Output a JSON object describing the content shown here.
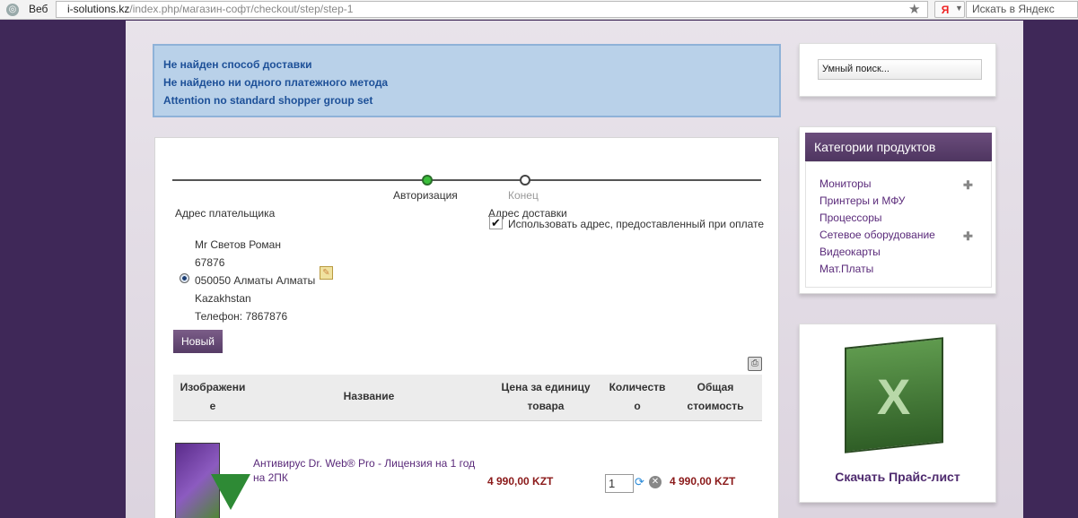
{
  "browser": {
    "tab_label": "Веб",
    "url_domain": "i-solutions.kz",
    "url_path": "/index.php/магазин-софт/checkout/step/step-1",
    "yandex_icon": "Я",
    "yandex_search": "Искать в Яндекс",
    "star_icon": "★"
  },
  "messages": [
    "Не найден способ доставки",
    "Не найдено ни одного платежного метода",
    "Attention no standard shopper group set"
  ],
  "checkout": {
    "steps": [
      "Авторизация",
      "Конец"
    ],
    "billing_label": "Адрес плательщика",
    "shipping_label": "Адрес доставки",
    "use_billing_label": "Использовать адрес, предоставленный при оплате",
    "checked_mark": "✔",
    "address": [
      "Mr Светов Роман",
      "67876",
      "050050 Алматы Алматы",
      "Kazakhstan",
      "Телефон: 7867876"
    ],
    "new_button": "Новый",
    "table": {
      "headers": {
        "image": [
          "Изображени",
          "е"
        ],
        "name": "Название",
        "price": [
          "Цена за единицу",
          "товара"
        ],
        "qty": [
          "Количеств",
          "о"
        ],
        "total": [
          "Общая",
          "стоимость"
        ]
      },
      "rows": [
        {
          "name": "Антивирус Dr. Web® Pro - Лицензия на 1 год на 2ПК",
          "price": "4 990,00 KZT",
          "qty": "1",
          "total": "4 990,00 KZT"
        }
      ]
    }
  },
  "sidebar": {
    "search_placeholder": "Умный поиск...",
    "categories_title": "Категории продуктов",
    "categories": [
      "Мониторы",
      "Принтеры и МФУ",
      "Процессоры",
      "Сетевое оборудование",
      "Видеокарты",
      "Мат.Платы"
    ],
    "expand_icon": "✚",
    "download_label": "Скачать Прайс-лист"
  },
  "colors": {
    "accent": "#563c66",
    "message_bg": "#b9d1e9",
    "price": "#8b1a1a"
  }
}
